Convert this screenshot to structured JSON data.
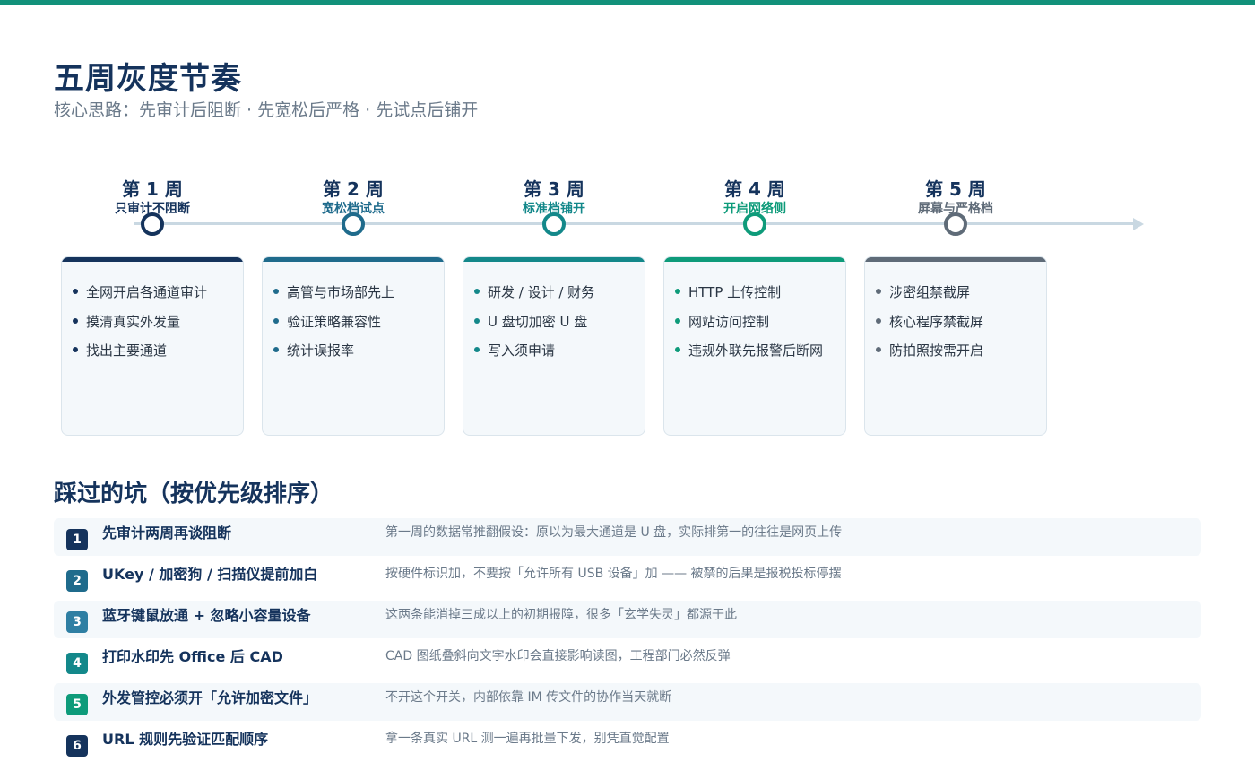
{
  "header": {
    "title": "五周灰度节奏",
    "subtitle": "核心思路：先审计后阻断 · 先宽松后严格 · 先试点后铺开"
  },
  "colors": {
    "accent": "#12917a",
    "navy": "#15335c",
    "week_colors": [
      "#15335c",
      "#1f6b8c",
      "#13888a",
      "#0e9b7a",
      "#5f6b78"
    ]
  },
  "weeks": [
    {
      "title": "第 1 周",
      "subtitle": "只审计不阻断",
      "items": [
        "全网开启各通道审计",
        "摸清真实外发量",
        "找出主要通道"
      ]
    },
    {
      "title": "第 2 周",
      "subtitle": "宽松档试点",
      "items": [
        "高管与市场部先上",
        "验证策略兼容性",
        "统计误报率"
      ]
    },
    {
      "title": "第 3 周",
      "subtitle": "标准档铺开",
      "items": [
        "研发 / 设计 / 财务",
        "U 盘切加密 U 盘",
        "写入须申请"
      ]
    },
    {
      "title": "第 4 周",
      "subtitle": "开启网络侧",
      "items": [
        "HTTP 上传控制",
        "网站访问控制",
        "违规外联先报警后断网"
      ]
    },
    {
      "title": "第 5 周",
      "subtitle": "屏幕与严格档",
      "items": [
        "涉密组禁截屏",
        "核心程序禁截屏",
        "防拍照按需开启"
      ]
    }
  ],
  "pitfalls": {
    "title": "踩过的坑（按优先级排序）",
    "items": [
      {
        "num": "1",
        "title": "先审计两周再谈阻断",
        "desc": "第一周的数据常推翻假设：原以为最大通道是 U 盘，实际排第一的往往是网页上传",
        "color": "#15335c"
      },
      {
        "num": "2",
        "title": "UKey / 加密狗 / 扫描仪提前加白",
        "desc": "按硬件标识加，不要按「允许所有 USB 设备」加 —— 被禁的后果是报税投标停摆",
        "color": "#1f6b8c"
      },
      {
        "num": "3",
        "title": "蓝牙键鼠放通 + 忽略小容量设备",
        "desc": "这两条能消掉三成以上的初期报障，很多「玄学失灵」都源于此",
        "color": "#2f7fa3"
      },
      {
        "num": "4",
        "title": "打印水印先 Office 后 CAD",
        "desc": "CAD 图纸叠斜向文字水印会直接影响读图，工程部门必然反弹",
        "color": "#13888a"
      },
      {
        "num": "5",
        "title": "外发管控必须开「允许加密文件」",
        "desc": "不开这个开关，内部依靠 IM 传文件的协作当天就断",
        "color": "#0e9b7a"
      },
      {
        "num": "6",
        "title": "URL 规则先验证匹配顺序",
        "desc": "拿一条真实 URL 测一遍再批量下发，别凭直觉配置",
        "color": "#15335c"
      }
    ]
  }
}
